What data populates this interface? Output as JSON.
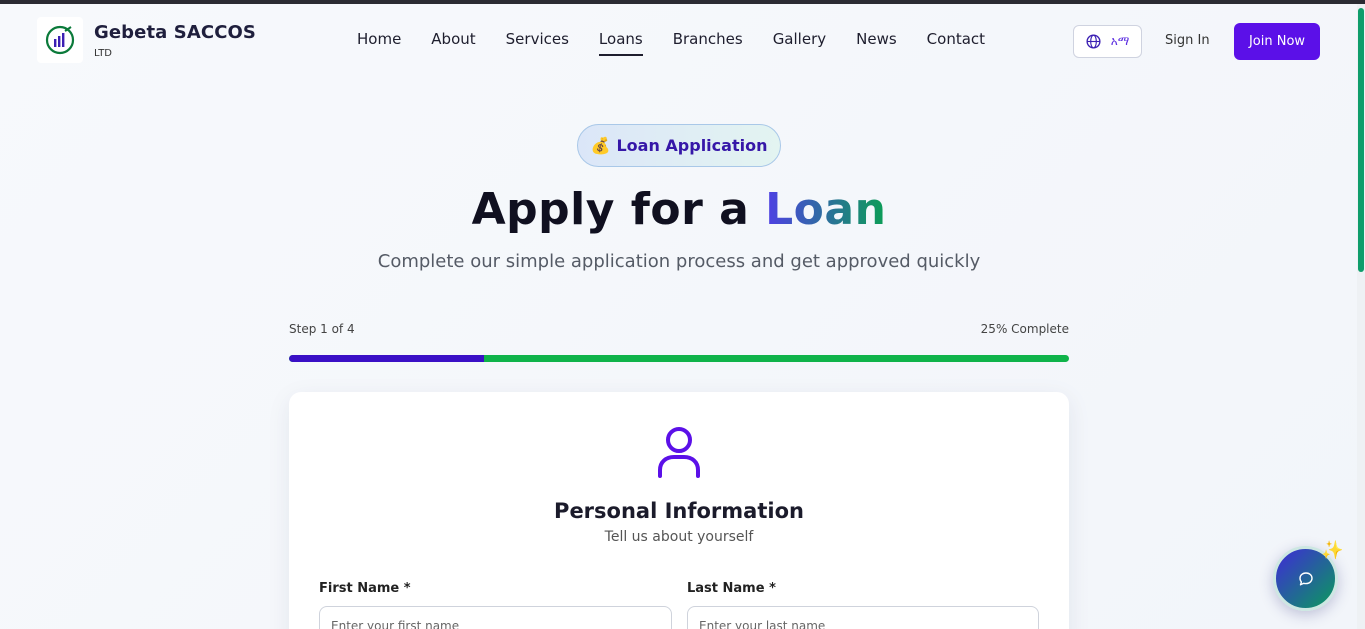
{
  "brand": {
    "name": "Gebeta SACCOS",
    "sub": "LTD"
  },
  "nav": {
    "items": [
      "Home",
      "About",
      "Services",
      "Loans",
      "Branches",
      "Gallery",
      "News",
      "Contact"
    ],
    "active": "Loans"
  },
  "header": {
    "lang_label": "አማ",
    "signin_label": "Sign In",
    "join_label": "Join Now"
  },
  "hero": {
    "badge_emoji": "💰",
    "badge_label": "Loan Application",
    "title_prefix": "Apply for a ",
    "title_highlight": "Loan",
    "subtitle": "Complete our simple application process and get approved quickly"
  },
  "progress": {
    "step_text": "Step 1 of 4",
    "percent_text": "25% Complete",
    "fraction": 0.25
  },
  "form": {
    "section_title": "Personal Information",
    "section_sub": "Tell us about yourself",
    "first_name": {
      "label": "First Name *",
      "placeholder": "Enter your first name",
      "value": ""
    },
    "last_name": {
      "label": "Last Name *",
      "placeholder": "Enter your last name",
      "value": ""
    }
  },
  "icons": {
    "logo": "chart-logo-icon",
    "language": "globe-icon",
    "profile": "user-icon",
    "chat": "chat-bubble-icon",
    "sparkle": "sparkle-icon"
  },
  "colors": {
    "primary": "#5b10e8",
    "progress_fill": "#3a10c6",
    "progress_track": "#0fb34a",
    "accent_green": "#0b9e55"
  }
}
